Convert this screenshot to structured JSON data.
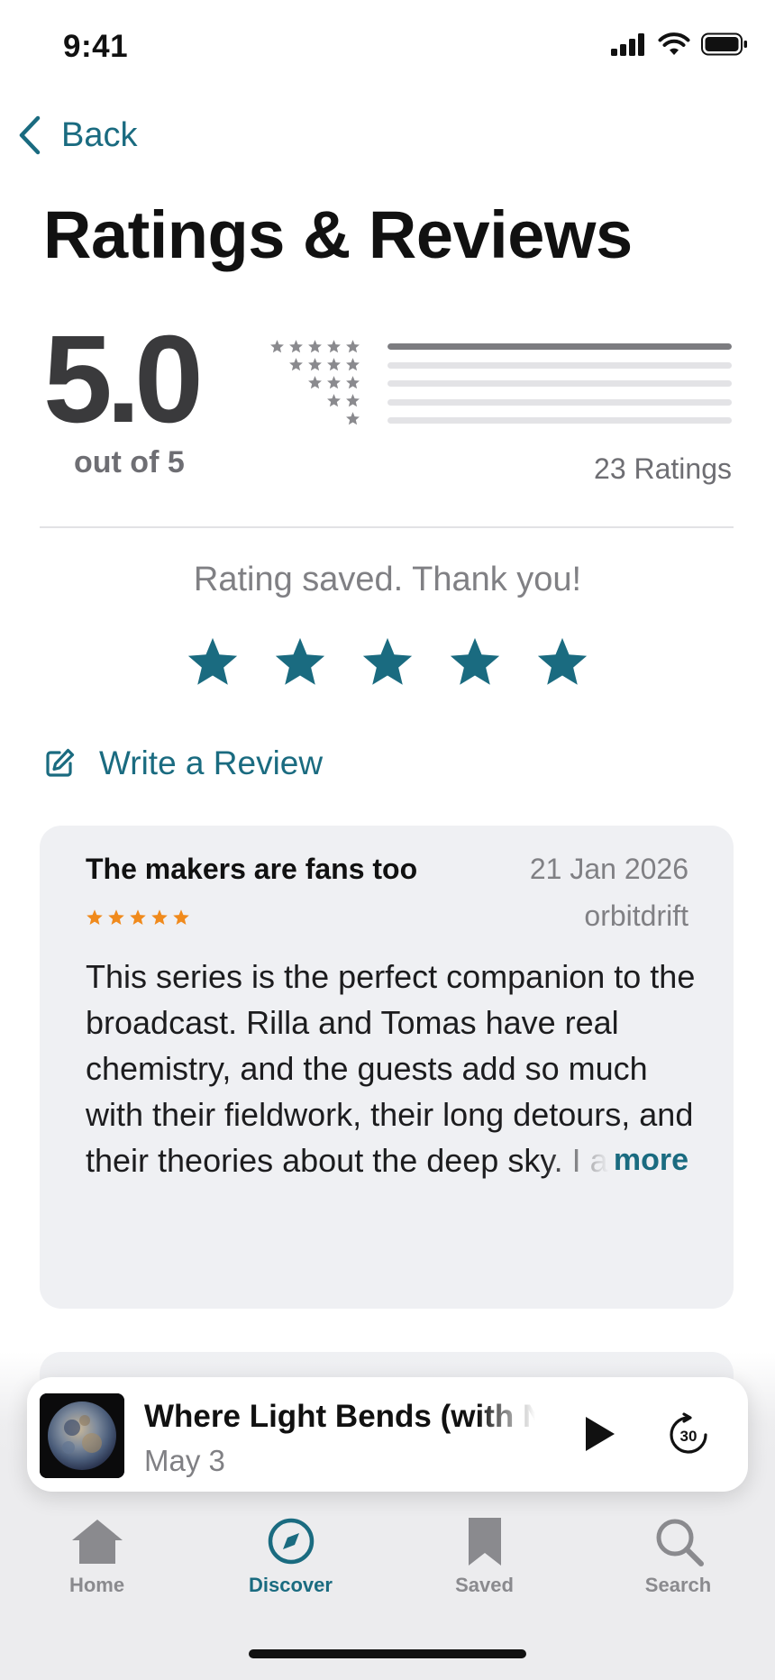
{
  "status_bar": {
    "time": "9:41"
  },
  "nav": {
    "back_label": "Back"
  },
  "page": {
    "title": "Ratings & Reviews"
  },
  "summary": {
    "average": "5.0",
    "out_of": "out of 5",
    "ratings_count": "23 Ratings",
    "distribution": [
      {
        "stars": 5,
        "fraction": 1.0
      },
      {
        "stars": 4,
        "fraction": 0.0
      },
      {
        "stars": 3,
        "fraction": 0.0
      },
      {
        "stars": 2,
        "fraction": 0.0
      },
      {
        "stars": 1,
        "fraction": 0.0
      }
    ]
  },
  "user_rating": {
    "message": "Rating saved. Thank you!",
    "stars": 5
  },
  "write_review": {
    "label": "Write a Review",
    "icon": "compose-icon"
  },
  "review": {
    "title": "The makers are fans too",
    "date": "21 Jan 2026",
    "author": "orbitdrift",
    "stars": 5,
    "body": "This series is the perfect companion to the broadcast. Rilla and Tomas have real chemistry, and the guests add so much with their fieldwork, their long detours, and their theories about the deep sky. I am glad to have somewhere to go further with them every week.",
    "more_label": "more"
  },
  "player": {
    "title": "Where Light Bends (with Nia",
    "date": "May 3",
    "skip_label": "30"
  },
  "tabs": [
    {
      "label": "Home",
      "icon": "home-icon",
      "active": false
    },
    {
      "label": "Discover",
      "icon": "compass-icon",
      "active": true
    },
    {
      "label": "Saved",
      "icon": "bookmark-icon",
      "active": false
    },
    {
      "label": "Search",
      "icon": "search-icon",
      "active": false
    }
  ],
  "colors": {
    "accent": "#1a6b80",
    "star_orange": "#f08a1c",
    "gray_text": "#808084",
    "card_bg": "#eff0f3"
  }
}
